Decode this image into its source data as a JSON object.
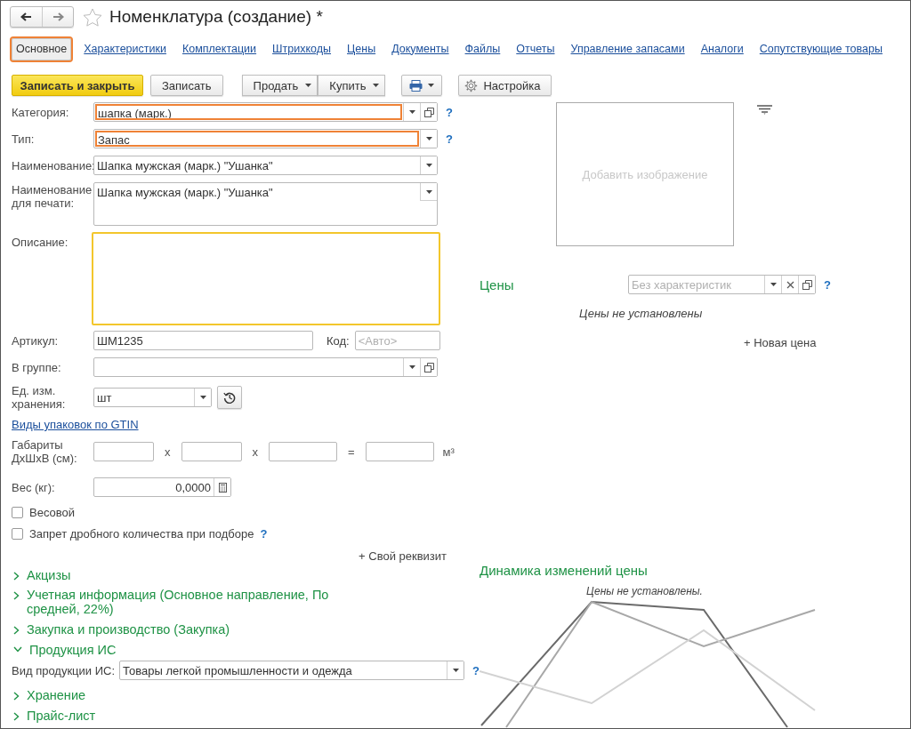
{
  "window": {
    "title": "Номенклатура (создание) *",
    "favorite": false
  },
  "tabs": [
    {
      "label": "Основное",
      "selected": true,
      "highlighted": true
    },
    {
      "label": "Характеристики",
      "selected": false,
      "highlighted": false
    },
    {
      "label": "Комплектации",
      "selected": false,
      "highlighted": false
    },
    {
      "label": "Штрихкоды",
      "selected": false,
      "highlighted": false
    },
    {
      "label": "Цены",
      "selected": false,
      "highlighted": false
    },
    {
      "label": "Документы",
      "selected": false,
      "highlighted": false
    },
    {
      "label": "Файлы",
      "selected": false,
      "highlighted": false
    },
    {
      "label": "Отчеты",
      "selected": false,
      "highlighted": false
    },
    {
      "label": "Управление запасами",
      "selected": false,
      "highlighted": false
    },
    {
      "label": "Аналоги",
      "selected": false,
      "highlighted": false
    },
    {
      "label": "Сопутствующие товары",
      "selected": false,
      "highlighted": false
    }
  ],
  "toolbar": [
    {
      "kind": "primary",
      "label": "Записать и закрыть"
    },
    {
      "kind": "plain",
      "label": "Записать"
    },
    {
      "kind": "menu",
      "label": "Продать"
    },
    {
      "kind": "menu",
      "label": "Купить"
    },
    {
      "kind": "print"
    },
    {
      "kind": "settings",
      "label": "Настройка"
    }
  ],
  "fields": [
    {
      "kind": "combo-open",
      "label": "Категория:",
      "value": "шапка (марк.)",
      "highlighted": true,
      "help": "?"
    },
    {
      "kind": "combo",
      "label": "Тип:",
      "value": "Запас",
      "highlighted": true,
      "help": "?"
    },
    {
      "kind": "combo",
      "label": "Наименование:",
      "value": "Шапка мужская (марк.) \"Ушанка\"",
      "highlighted": false
    },
    {
      "kind": "multiline-combo",
      "label": "Наименование для печати:",
      "value": "Шапка мужская (марк.) \"Ушанка\"",
      "highlighted": false
    },
    {
      "kind": "textarea",
      "label": "Описание:",
      "focused": true
    }
  ],
  "article": {
    "label": "Артикул:",
    "value": "ШМ1235"
  },
  "code": {
    "label": "Код:",
    "placeholder": "<Авто>"
  },
  "group": {
    "label": "В группе:"
  },
  "unit": {
    "label": "Ед. изм. хранения:",
    "value": "шт"
  },
  "gtin_link": "Виды упаковок по GTIN",
  "dimensions": {
    "label": "Габариты ДхШхВ (см):",
    "separators": [
      "х",
      "х",
      "="
    ],
    "unit": "м³"
  },
  "weight": {
    "label": "Вес (кг):",
    "value": "0,0000"
  },
  "checkboxes": [
    {
      "label": "Весовой",
      "checked": false
    },
    {
      "label": "Запрет дробного количества при подборе",
      "checked": false,
      "help": "?"
    }
  ],
  "add_attribute": "+ Свой реквизит",
  "sections": [
    {
      "title": "Акцизы",
      "expanded": false
    },
    {
      "title": "Учетная информация (Основное направление, По средней, 22%)",
      "expanded": false
    },
    {
      "title": "Закупка и производство (Закупка)",
      "expanded": false
    },
    {
      "title": "Продукция ИС",
      "expanded": true,
      "fields": [
        {
          "label": "Вид продукции ИС:",
          "value": "Товары легкой промышленности и одежда",
          "help": "?"
        }
      ]
    },
    {
      "title": "Хранение",
      "expanded": false
    },
    {
      "title": "Прайс-лист",
      "expanded": false
    }
  ],
  "image": {
    "placeholder": "Добавить изображение"
  },
  "prices": {
    "title": "Цены",
    "placeholder": "Без характеристик",
    "help": "?",
    "empty_text": "Цены не установлены",
    "new_price": "+ Новая цена"
  },
  "price_chart": {
    "title": "Динамика изменений цены",
    "empty_text": "Цены не установлены."
  }
}
